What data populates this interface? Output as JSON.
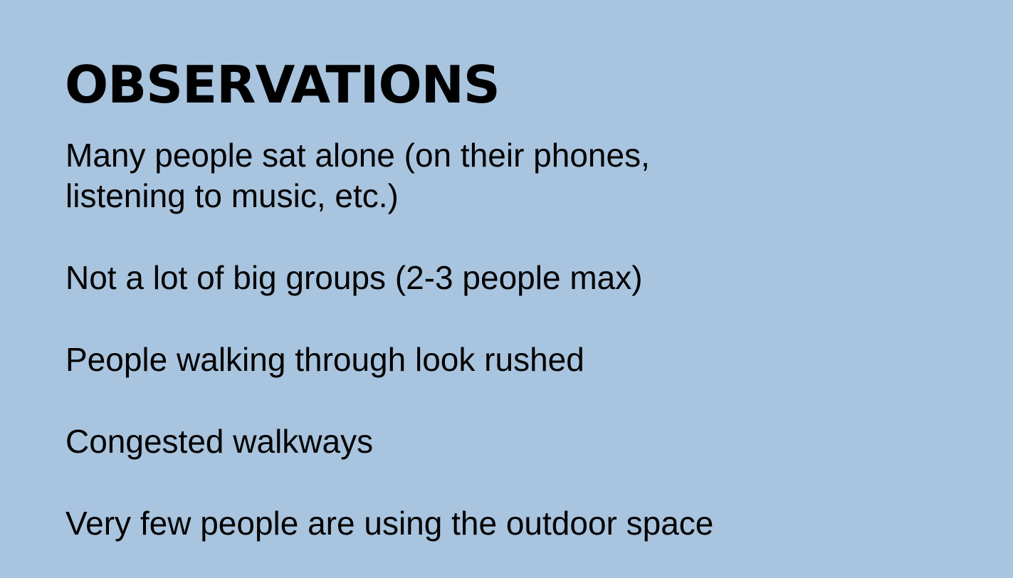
{
  "slide": {
    "title": "OBSERVATIONS",
    "background_color": "#a9c4de",
    "text_color": "#000000",
    "observations": [
      "Many people sat alone (on their phones,\nlistening to music, etc.)",
      "Not a lot of big groups (2-3 people max)",
      "People walking through look rushed",
      "Congested walkways",
      "Very few people are using the outdoor space"
    ]
  }
}
